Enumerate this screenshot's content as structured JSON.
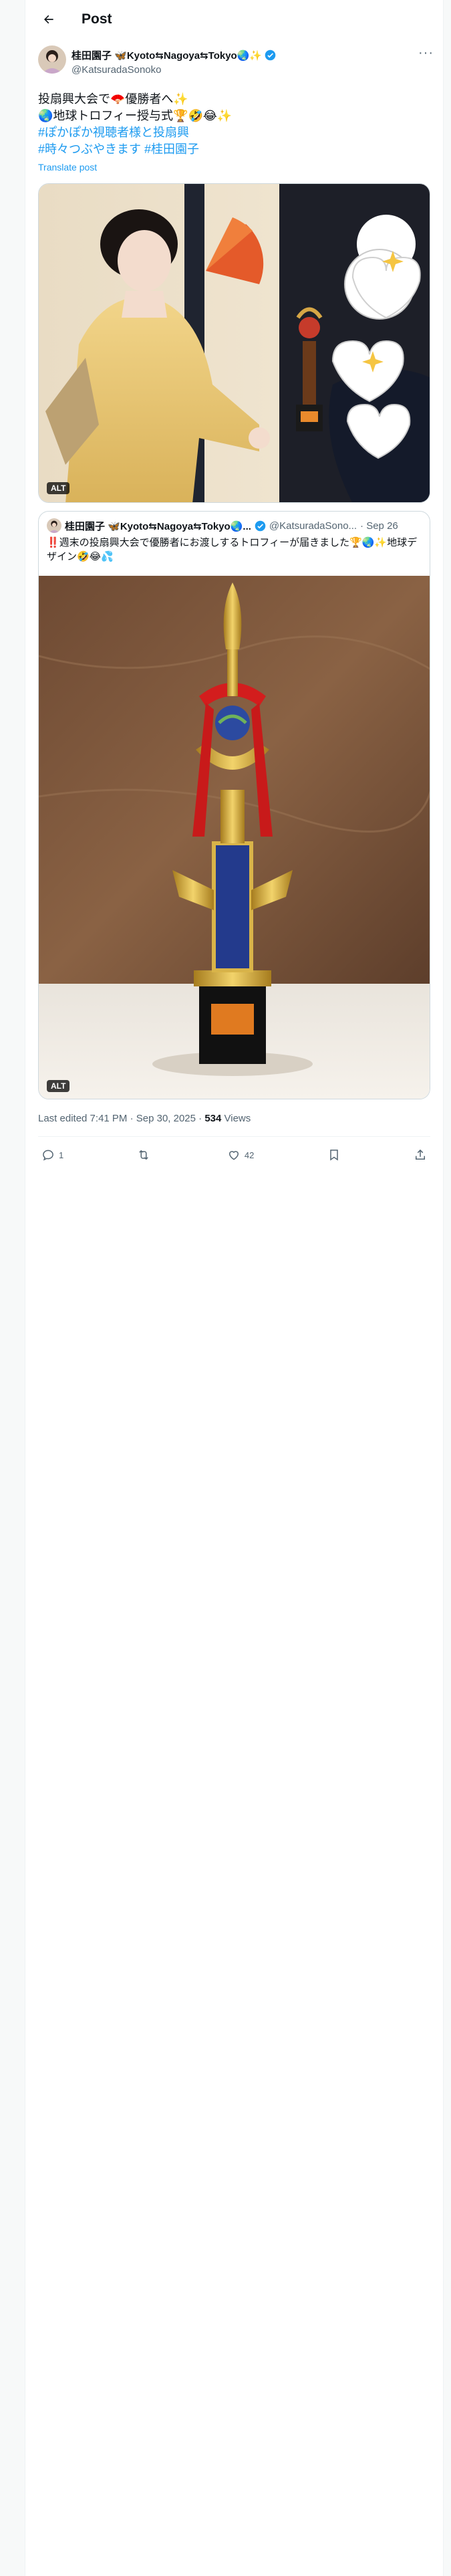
{
  "header": {
    "title": "Post"
  },
  "author": {
    "name": "桂田園子 🦋Kyoto⇆Nagoya⇆Tokyo🌏✨",
    "handle": "@KatsuradaSonoko"
  },
  "post": {
    "lines": [
      "投扇興大会で🪭優勝者へ✨",
      "🌏地球トロフィー授与式🏆🤣😂✨"
    ],
    "hashtag_lines": [
      "#ぽかぽか視聴者様と投扇興",
      "#時々つぶやきます #桂田園子"
    ],
    "translate": "Translate post",
    "media_alt": "ALT"
  },
  "quote": {
    "name": "桂田園子 🦋Kyoto⇆Nagoya⇆Tokyo🌏...",
    "handle": "@KatsuradaSono...",
    "date": "· Sep 26",
    "text": "‼️週末の投扇興大会で優勝者にお渡しするトロフィーが届きました🏆🌏✨地球デザイン🤣😂💦",
    "media_alt": "ALT"
  },
  "meta": {
    "prefix": "Last edited 7:41 PM · Sep 30, 2025 · ",
    "views_count": "534",
    "views_label": " Views"
  },
  "actions": {
    "replies": "1",
    "reposts": "",
    "likes": "42"
  },
  "colors": {
    "accent": "#1d9bf0",
    "muted": "#536471",
    "border": "#cfd9de"
  }
}
